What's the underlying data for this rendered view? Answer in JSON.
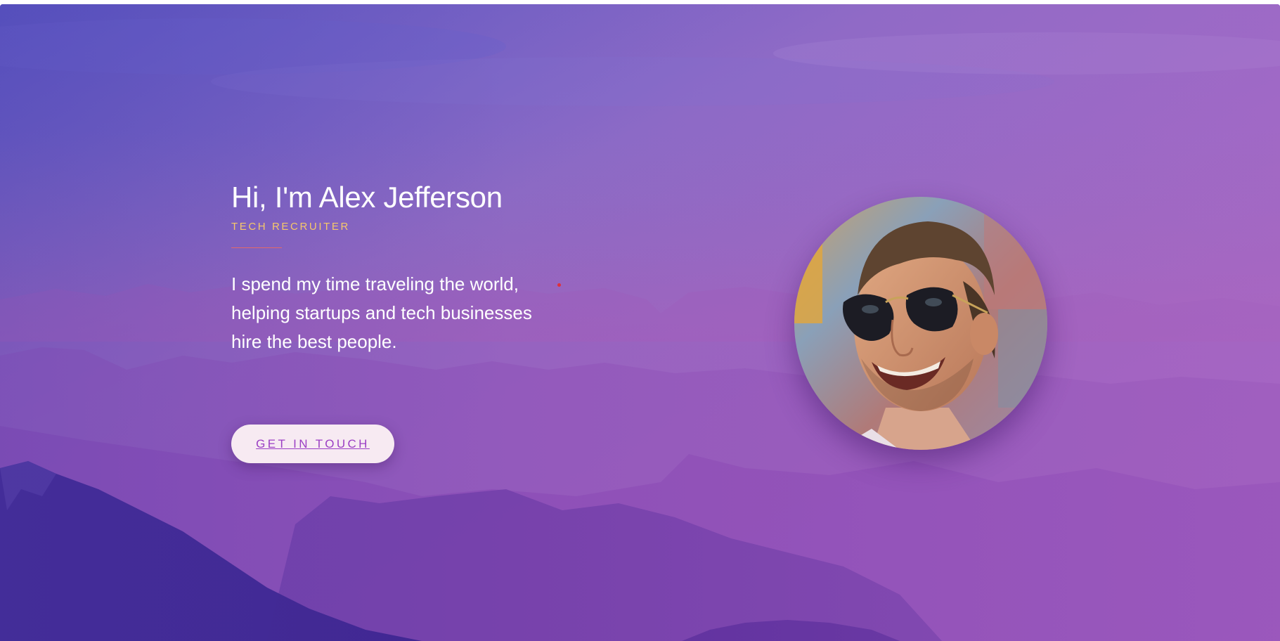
{
  "hero": {
    "headline": "Hi, I'm Alex Jefferson",
    "role": "TECH RECRUITER",
    "bio": "I spend my time traveling the world, helping startups and tech businesses hire the best people.",
    "cta_label": "GET IN TOUCH"
  },
  "colors": {
    "role_accent": "#f6c86a",
    "divider": "#e36a6a",
    "cta_background": "#f7eaf2",
    "cta_text": "#9b3fc4"
  },
  "icons": {
    "avatar": "portrait-photo",
    "background": "mountain-landscape"
  }
}
